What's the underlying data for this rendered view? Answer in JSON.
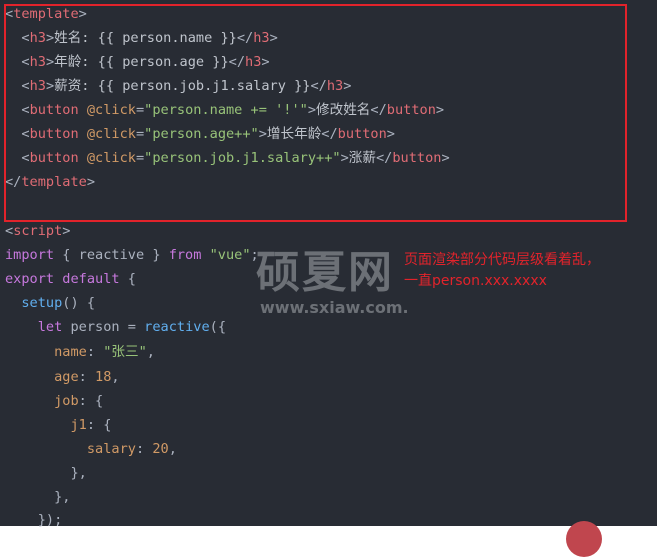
{
  "editor": {
    "theme_colors": {
      "background": "#282c34",
      "tag": "#e06c75",
      "string": "#98c379",
      "keyword": "#c678dd",
      "function": "#61afef",
      "property": "#d19a66",
      "highlight_box": "#e2232b"
    },
    "template_lines": {
      "l1": {
        "open": "<",
        "tag": "template",
        "close": ">"
      },
      "l2": {
        "lt": "<",
        "tag": "h3",
        "gt": ">",
        "text": "姓名: {{ person.name }}",
        "lt2": "</",
        "tag2": "h3",
        "gt2": ">"
      },
      "l3": {
        "lt": "<",
        "tag": "h3",
        "gt": ">",
        "text": "年龄: {{ person.age }}",
        "lt2": "</",
        "tag2": "h3",
        "gt2": ">"
      },
      "l4": {
        "lt": "<",
        "tag": "h3",
        "gt": ">",
        "text": "薪资: {{ person.job.j1.salary }}",
        "lt2": "</",
        "tag2": "h3",
        "gt2": ">"
      },
      "l5": {
        "lt": "<",
        "tag": "button",
        "attr": " @click",
        "eq": "=",
        "val": "\"person.name += '!'\"",
        "gt": ">",
        "text": "修改姓名",
        "lt2": "</",
        "tag2": "button",
        "gt2": ">"
      },
      "l6": {
        "lt": "<",
        "tag": "button",
        "attr": " @click",
        "eq": "=",
        "val": "\"person.age++\"",
        "gt": ">",
        "text": "增长年龄",
        "lt2": "</",
        "tag2": "button",
        "gt2": ">"
      },
      "l7": {
        "lt": "<",
        "tag": "button",
        "attr": " @click",
        "eq": "=",
        "val": "\"person.job.j1.salary++\"",
        "gt": ">",
        "text": "涨薪",
        "lt2": "</",
        "tag2": "button",
        "gt2": ">"
      },
      "l8": {
        "open": "</",
        "tag": "template",
        "close": ">"
      }
    },
    "script_lines": {
      "s1": {
        "open": "<",
        "tag": "script",
        "close": ">"
      },
      "s2": {
        "kw": "import",
        "mid": " { reactive } ",
        "kw2": "from",
        "sp": " ",
        "str": "\"vue\"",
        "end": ";"
      },
      "s3": {
        "kw": "export",
        "sp": " ",
        "kw2": "default",
        "end": " {"
      },
      "s4": {
        "indent": "  ",
        "fn": "setup",
        "end": "() {"
      },
      "s5": {
        "indent": "    ",
        "kw": "let",
        "mid": " person = ",
        "fn": "reactive",
        "end": "({"
      },
      "s6": {
        "indent": "      ",
        "prop": "name",
        "mid": ": ",
        "str": "\"张三\"",
        "end": ","
      },
      "s7": {
        "indent": "      ",
        "prop": "age",
        "mid": ": ",
        "num": "18",
        "end": ","
      },
      "s8": {
        "indent": "      ",
        "prop": "job",
        "end": ": {"
      },
      "s9": {
        "indent": "        ",
        "prop": "j1",
        "end": ": {"
      },
      "s10": {
        "indent": "          ",
        "prop": "salary",
        "mid": ": ",
        "num": "20",
        "end": ","
      },
      "s11": {
        "text": "        },"
      },
      "s12": {
        "text": "      },"
      },
      "s13": {
        "text": "    });"
      }
    }
  },
  "watermark": {
    "title": "硕夏网",
    "url": "www.sxiaw.com."
  },
  "annotation": {
    "line1": "页面渲染部分代码层级看着乱，",
    "line2": "一直person.xxx.xxxx"
  }
}
